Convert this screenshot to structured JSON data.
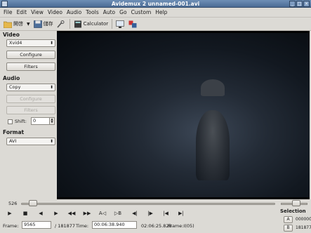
{
  "window": {
    "title": "Avidemux 2 unnamed-001.avi"
  },
  "menu": [
    "File",
    "Edit",
    "View",
    "Video",
    "Audio",
    "Tools",
    "Auto",
    "Go",
    "Custom",
    "Help"
  ],
  "toolbar": {
    "open_label": "開啓",
    "save_label": "儲存",
    "calculator_label": "Calculator"
  },
  "video_section": {
    "title": "Video",
    "codec": "Xvid4",
    "configure": "Configure",
    "filters": "Filters"
  },
  "audio_section": {
    "title": "Audio",
    "codec": "Copy",
    "configure": "Configure",
    "filters": "Filters",
    "shift_label": "Shift:",
    "shift_value": "0"
  },
  "format_section": {
    "title": "Format",
    "container": "AVI"
  },
  "slider": {
    "current_label": "526",
    "position_fraction": 0.03
  },
  "controls": [
    "▶",
    "■",
    "◀",
    "▶",
    "◀◀",
    "▶▶",
    "A◁",
    "▷B",
    "◀|",
    "|▶",
    "|◀",
    "▶|"
  ],
  "selection": {
    "title": "Selection",
    "a_label": "A",
    "a_value": "000000",
    "b_label": "B",
    "b_value": "181877"
  },
  "status": {
    "frame_label": "Frame:",
    "frame_value": "9565",
    "total": "/ 181877",
    "time_label": "Time:",
    "time_value": "00:06:38.940",
    "duration": "02:06:25.828",
    "frame_type": "Frame:I(05)"
  }
}
